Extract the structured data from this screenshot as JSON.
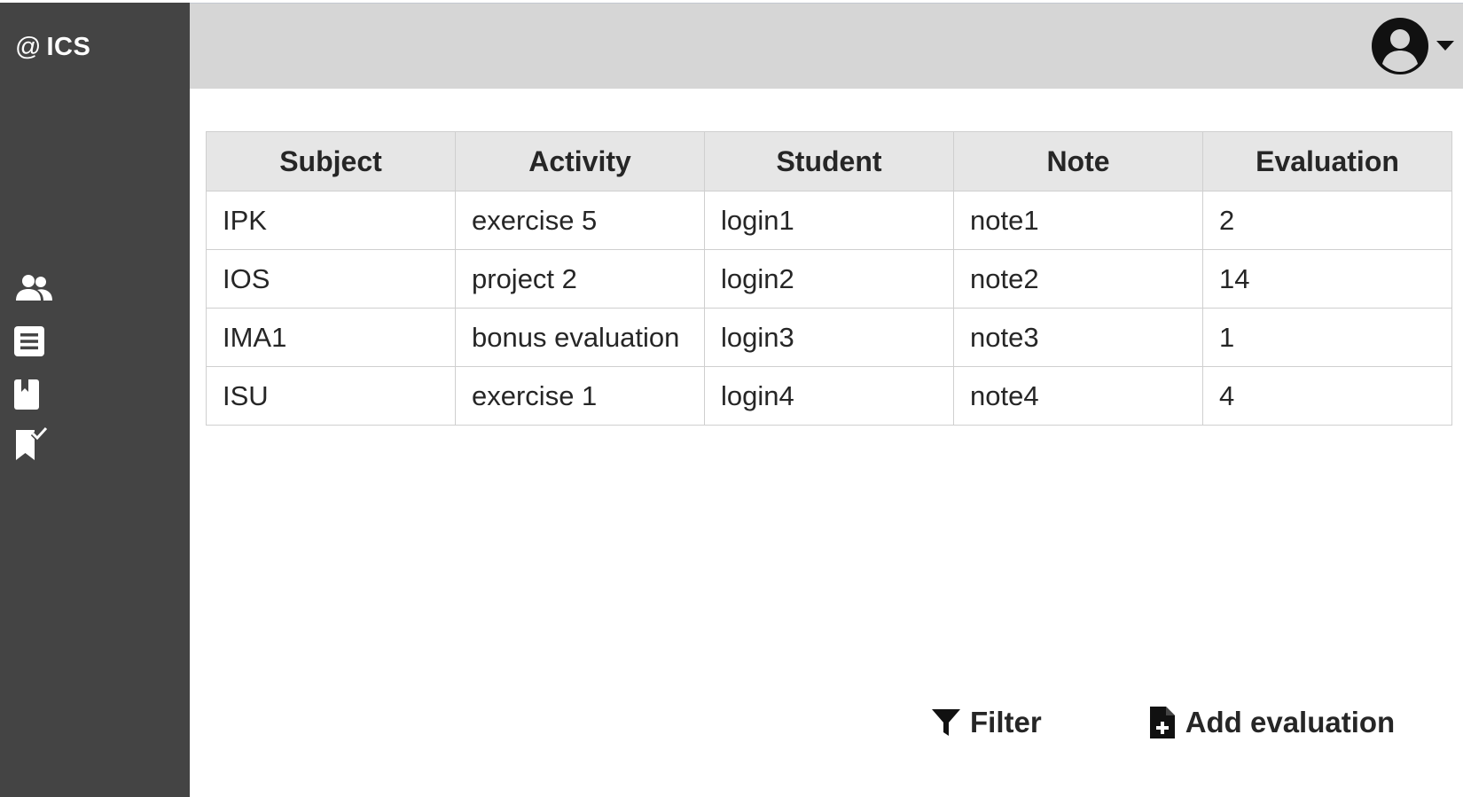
{
  "app": {
    "logo_symbol": "@",
    "logo_name": "ICS"
  },
  "sidebar": {
    "items": [
      {
        "icon": "users-icon"
      },
      {
        "icon": "list-icon"
      },
      {
        "icon": "book-icon"
      },
      {
        "icon": "bookmark-check-icon"
      }
    ]
  },
  "header": {
    "user_icon": "user-circle-icon",
    "dropdown_icon": "caret-down-icon"
  },
  "table": {
    "headers": [
      "Subject",
      "Activity",
      "Student",
      "Note",
      "Evaluation"
    ],
    "rows": [
      [
        "IPK",
        "exercise 5",
        "login1",
        "note1",
        "2"
      ],
      [
        "IOS",
        "project 2",
        "login2",
        "note2",
        "14"
      ],
      [
        "IMA1",
        "bonus evaluation",
        "login3",
        "note3",
        "1"
      ],
      [
        "ISU",
        "exercise 1",
        "login4",
        "note4",
        "4"
      ]
    ]
  },
  "actions": {
    "filter_label": "Filter",
    "add_label": "Add evaluation"
  },
  "colors": {
    "sidebar_bg": "#444444",
    "topbar_bg": "#d6d6d6",
    "header_bg": "#e6e6e6"
  }
}
